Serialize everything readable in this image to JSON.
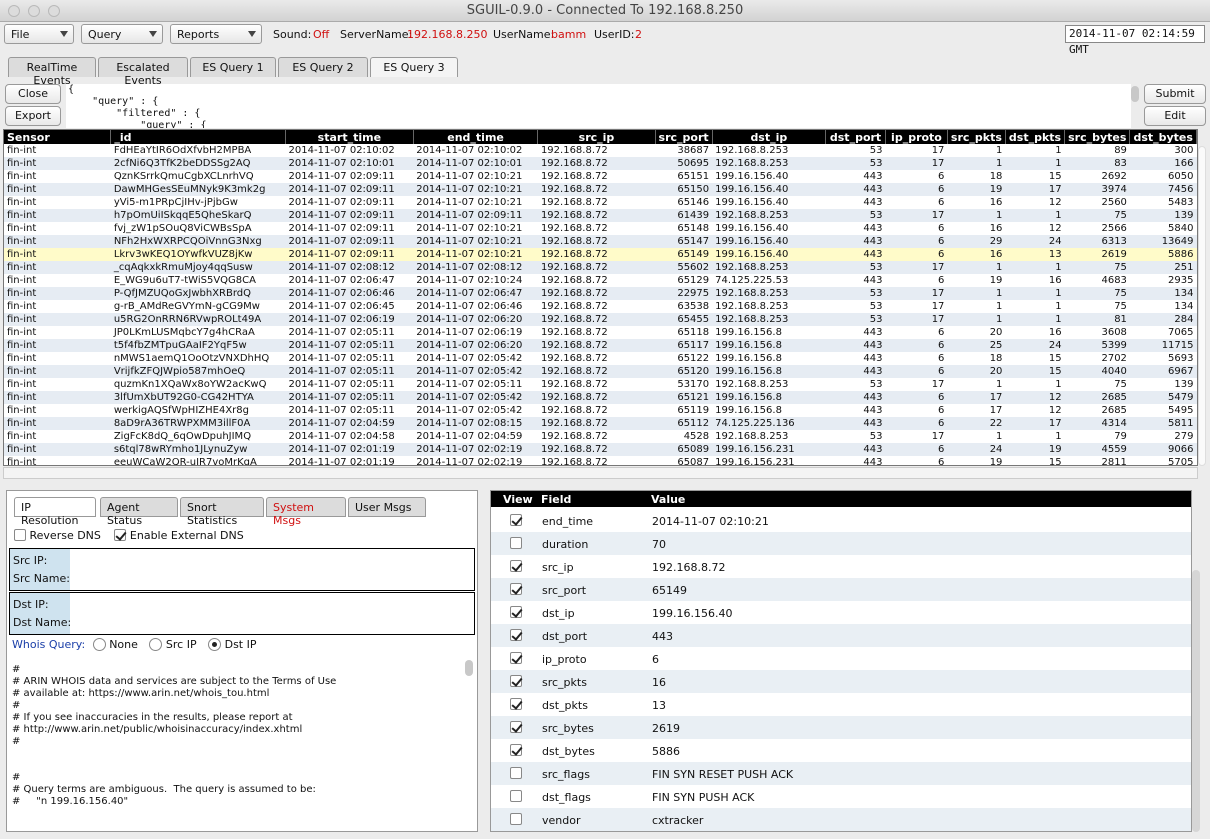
{
  "window": {
    "title": "SGUIL-0.9.0 - Connected To 192.168.8.250"
  },
  "menus": {
    "file": "File",
    "query": "Query",
    "reports": "Reports"
  },
  "status": {
    "sound_label": "Sound:",
    "sound_value": "Off",
    "server_label": "ServerName:",
    "server_value": "192.168.8.250",
    "user_label": "UserName:",
    "user_value": "bamm",
    "userid_label": "UserID:",
    "userid_value": "2",
    "clock": "2014-11-07 02:14:59 GMT"
  },
  "tabs": [
    "RealTime Events",
    "Escalated Events",
    "ES Query 1",
    "ES Query 2",
    "ES Query 3"
  ],
  "query_buttons": {
    "close": "Close",
    "export": "Export",
    "submit": "Submit",
    "edit": "Edit"
  },
  "query_text": "{\n    \"query\" : {\n        \"filtered\" : {\n            \"query\" : {",
  "columns": [
    "Sensor",
    "_id",
    "start_time",
    "end_time",
    "src_ip",
    "src_port",
    "dst_ip",
    "dst_port",
    "ip_proto",
    "src_pkts",
    "dst_pkts",
    "src_bytes",
    "dst_bytes"
  ],
  "rows": [
    [
      "fin-int",
      "FdHEaYtIR6OdXfvbH2MPBA",
      "2014-11-07 02:10:02",
      "2014-11-07 02:10:02",
      "192.168.8.72",
      "38687",
      "192.168.8.253",
      "53",
      "17",
      "1",
      "1",
      "89",
      "300"
    ],
    [
      "fin-int",
      "2cfNi6Q3TfK2beDDSSg2AQ",
      "2014-11-07 02:10:01",
      "2014-11-07 02:10:01",
      "192.168.8.72",
      "50695",
      "192.168.8.253",
      "53",
      "17",
      "1",
      "1",
      "83",
      "166"
    ],
    [
      "fin-int",
      "QznKSrrkQmuCgbXCLnrhVQ",
      "2014-11-07 02:09:11",
      "2014-11-07 02:10:21",
      "192.168.8.72",
      "65151",
      "199.16.156.40",
      "443",
      "6",
      "18",
      "15",
      "2692",
      "6050"
    ],
    [
      "fin-int",
      "DawMHGesSEuMNyk9K3mk2g",
      "2014-11-07 02:09:11",
      "2014-11-07 02:10:21",
      "192.168.8.72",
      "65150",
      "199.16.156.40",
      "443",
      "6",
      "19",
      "17",
      "3974",
      "7456"
    ],
    [
      "fin-int",
      "yVi5-m1PRpCjIHv-jPjbGw",
      "2014-11-07 02:09:11",
      "2014-11-07 02:10:21",
      "192.168.8.72",
      "65146",
      "199.16.156.40",
      "443",
      "6",
      "16",
      "12",
      "2560",
      "5483"
    ],
    [
      "fin-int",
      "h7pOmUiISkqqE5QheSkarQ",
      "2014-11-07 02:09:11",
      "2014-11-07 02:09:11",
      "192.168.8.72",
      "61439",
      "192.168.8.253",
      "53",
      "17",
      "1",
      "1",
      "75",
      "139"
    ],
    [
      "fin-int",
      "fvj_zW1pSOuQ8ViCWBsSpA",
      "2014-11-07 02:09:11",
      "2014-11-07 02:10:21",
      "192.168.8.72",
      "65148",
      "199.16.156.40",
      "443",
      "6",
      "16",
      "12",
      "2566",
      "5840"
    ],
    [
      "fin-int",
      "NFh2HxWXRPCQOiVnnG3Nxg",
      "2014-11-07 02:09:11",
      "2014-11-07 02:10:21",
      "192.168.8.72",
      "65147",
      "199.16.156.40",
      "443",
      "6",
      "29",
      "24",
      "6313",
      "13649"
    ],
    [
      "fin-int",
      "Lkrv3wKEQ1OYwfkVUZ8jKw",
      "2014-11-07 02:09:11",
      "2014-11-07 02:10:21",
      "192.168.8.72",
      "65149",
      "199.16.156.40",
      "443",
      "6",
      "16",
      "13",
      "2619",
      "5886"
    ],
    [
      "fin-int",
      "_cqAqkxkRmuMjoy4qqSusw",
      "2014-11-07 02:08:12",
      "2014-11-07 02:08:12",
      "192.168.8.72",
      "55602",
      "192.168.8.253",
      "53",
      "17",
      "1",
      "1",
      "75",
      "251"
    ],
    [
      "fin-int",
      "E_WG9u6uT7-tWiS5VQG8CA",
      "2014-11-07 02:06:47",
      "2014-11-07 02:10:24",
      "192.168.8.72",
      "65129",
      "74.125.225.53",
      "443",
      "6",
      "19",
      "16",
      "4683",
      "2935"
    ],
    [
      "fin-int",
      "P-QfJMZUQoGxJwbhXRBrdQ",
      "2014-11-07 02:06:46",
      "2014-11-07 02:06:47",
      "192.168.8.72",
      "22975",
      "192.168.8.253",
      "53",
      "17",
      "1",
      "1",
      "75",
      "134"
    ],
    [
      "fin-int",
      "g-rB_AMdReGVYmN-gCG9Mw",
      "2014-11-07 02:06:45",
      "2014-11-07 02:06:46",
      "192.168.8.72",
      "63538",
      "192.168.8.253",
      "53",
      "17",
      "1",
      "1",
      "75",
      "134"
    ],
    [
      "fin-int",
      "u5RG2OnRRN6RVwpROLt49A",
      "2014-11-07 02:06:19",
      "2014-11-07 02:06:20",
      "192.168.8.72",
      "65455",
      "192.168.8.253",
      "53",
      "17",
      "1",
      "1",
      "81",
      "284"
    ],
    [
      "fin-int",
      "JP0LKmLUSMqbcY7g4hCRaA",
      "2014-11-07 02:05:11",
      "2014-11-07 02:06:19",
      "192.168.8.72",
      "65118",
      "199.16.156.8",
      "443",
      "6",
      "20",
      "16",
      "3608",
      "7065"
    ],
    [
      "fin-int",
      "t5f4fbZMTpuGAaIF2YqF5w",
      "2014-11-07 02:05:11",
      "2014-11-07 02:06:20",
      "192.168.8.72",
      "65117",
      "199.16.156.8",
      "443",
      "6",
      "25",
      "24",
      "5399",
      "11715"
    ],
    [
      "fin-int",
      "nMWS1aemQ1OoOtzVNXDhHQ",
      "2014-11-07 02:05:11",
      "2014-11-07 02:05:42",
      "192.168.8.72",
      "65122",
      "199.16.156.8",
      "443",
      "6",
      "18",
      "15",
      "2702",
      "5693"
    ],
    [
      "fin-int",
      "VrijfkZFQJWpio587mhOeQ",
      "2014-11-07 02:05:11",
      "2014-11-07 02:05:42",
      "192.168.8.72",
      "65120",
      "199.16.156.8",
      "443",
      "6",
      "20",
      "15",
      "4040",
      "6967"
    ],
    [
      "fin-int",
      "quzmKn1XQaWx8oYW2acKwQ",
      "2014-11-07 02:05:11",
      "2014-11-07 02:05:11",
      "192.168.8.72",
      "53170",
      "192.168.8.253",
      "53",
      "17",
      "1",
      "1",
      "75",
      "139"
    ],
    [
      "fin-int",
      "3lfUmXbUT92G0-CG42HTYA",
      "2014-11-07 02:05:11",
      "2014-11-07 02:05:42",
      "192.168.8.72",
      "65121",
      "199.16.156.8",
      "443",
      "6",
      "17",
      "12",
      "2685",
      "5479"
    ],
    [
      "fin-int",
      "werkigAQSfWpHIZHE4Xr8g",
      "2014-11-07 02:05:11",
      "2014-11-07 02:05:42",
      "192.168.8.72",
      "65119",
      "199.16.156.8",
      "443",
      "6",
      "17",
      "12",
      "2685",
      "5495"
    ],
    [
      "fin-int",
      "8aD9rA36TRWPXMM3illF0A",
      "2014-11-07 02:04:59",
      "2014-11-07 02:08:15",
      "192.168.8.72",
      "65112",
      "74.125.225.136",
      "443",
      "6",
      "22",
      "17",
      "4314",
      "5811"
    ],
    [
      "fin-int",
      "ZigFcK8dQ_6qOwDpuhJIMQ",
      "2014-11-07 02:04:58",
      "2014-11-07 02:04:59",
      "192.168.8.72",
      "4528",
      "192.168.8.253",
      "53",
      "17",
      "1",
      "1",
      "79",
      "279"
    ],
    [
      "fin-int",
      "s6tql78wRYmho1JLynuZyw",
      "2014-11-07 02:01:19",
      "2014-11-07 02:02:19",
      "192.168.8.72",
      "65089",
      "199.16.156.231",
      "443",
      "6",
      "24",
      "19",
      "4559",
      "9066"
    ],
    [
      "fin-int",
      "eeuWCaW2QR-uIR7voMrKqA",
      "2014-11-07 02:01:19",
      "2014-11-07 02:02:19",
      "192.168.8.72",
      "65087",
      "199.16.156.231",
      "443",
      "6",
      "19",
      "15",
      "2811",
      "5705"
    ]
  ],
  "selected_row": 8,
  "left_tabs": [
    "IP Resolution",
    "Agent Status",
    "Snort Statistics",
    "System Msgs",
    "User Msgs"
  ],
  "dns": {
    "reverse": "Reverse DNS",
    "external": "Enable External DNS"
  },
  "src_box": {
    "ip": "Src IP:",
    "name": "Src Name:"
  },
  "dst_box": {
    "ip": "Dst IP:",
    "name": "Dst Name:"
  },
  "whois_query": {
    "label": "Whois Query:",
    "none": "None",
    "src": "Src IP",
    "dst": "Dst IP"
  },
  "whois_text": "#\n# ARIN WHOIS data and services are subject to the Terms of Use\n# available at: https://www.arin.net/whois_tou.html\n#\n# If you see inaccuracies in the results, please report at\n# http://www.arin.net/public/whoisinaccuracy/index.xhtml\n#\n\n\n#\n# Query terms are ambiguous.  The query is assumed to be:\n#     \"n 199.16.156.40\"",
  "detail_headers": {
    "view": "View",
    "field": "Field",
    "value": "Value"
  },
  "details": [
    {
      "view": true,
      "field": "end_time",
      "value": "2014-11-07 02:10:21"
    },
    {
      "view": false,
      "field": "duration",
      "value": "70"
    },
    {
      "view": true,
      "field": "src_ip",
      "value": "192.168.8.72"
    },
    {
      "view": true,
      "field": "src_port",
      "value": "65149"
    },
    {
      "view": true,
      "field": "dst_ip",
      "value": "199.16.156.40"
    },
    {
      "view": true,
      "field": "dst_port",
      "value": "443"
    },
    {
      "view": true,
      "field": "ip_proto",
      "value": "6"
    },
    {
      "view": true,
      "field": "src_pkts",
      "value": "16"
    },
    {
      "view": true,
      "field": "dst_pkts",
      "value": "13"
    },
    {
      "view": true,
      "field": "src_bytes",
      "value": "2619"
    },
    {
      "view": true,
      "field": "dst_bytes",
      "value": "5886"
    },
    {
      "view": false,
      "field": "src_flags",
      "value": "FIN SYN RESET PUSH ACK"
    },
    {
      "view": false,
      "field": "dst_flags",
      "value": "FIN SYN PUSH ACK"
    },
    {
      "view": false,
      "field": "vendor",
      "value": "cxtracker"
    }
  ]
}
